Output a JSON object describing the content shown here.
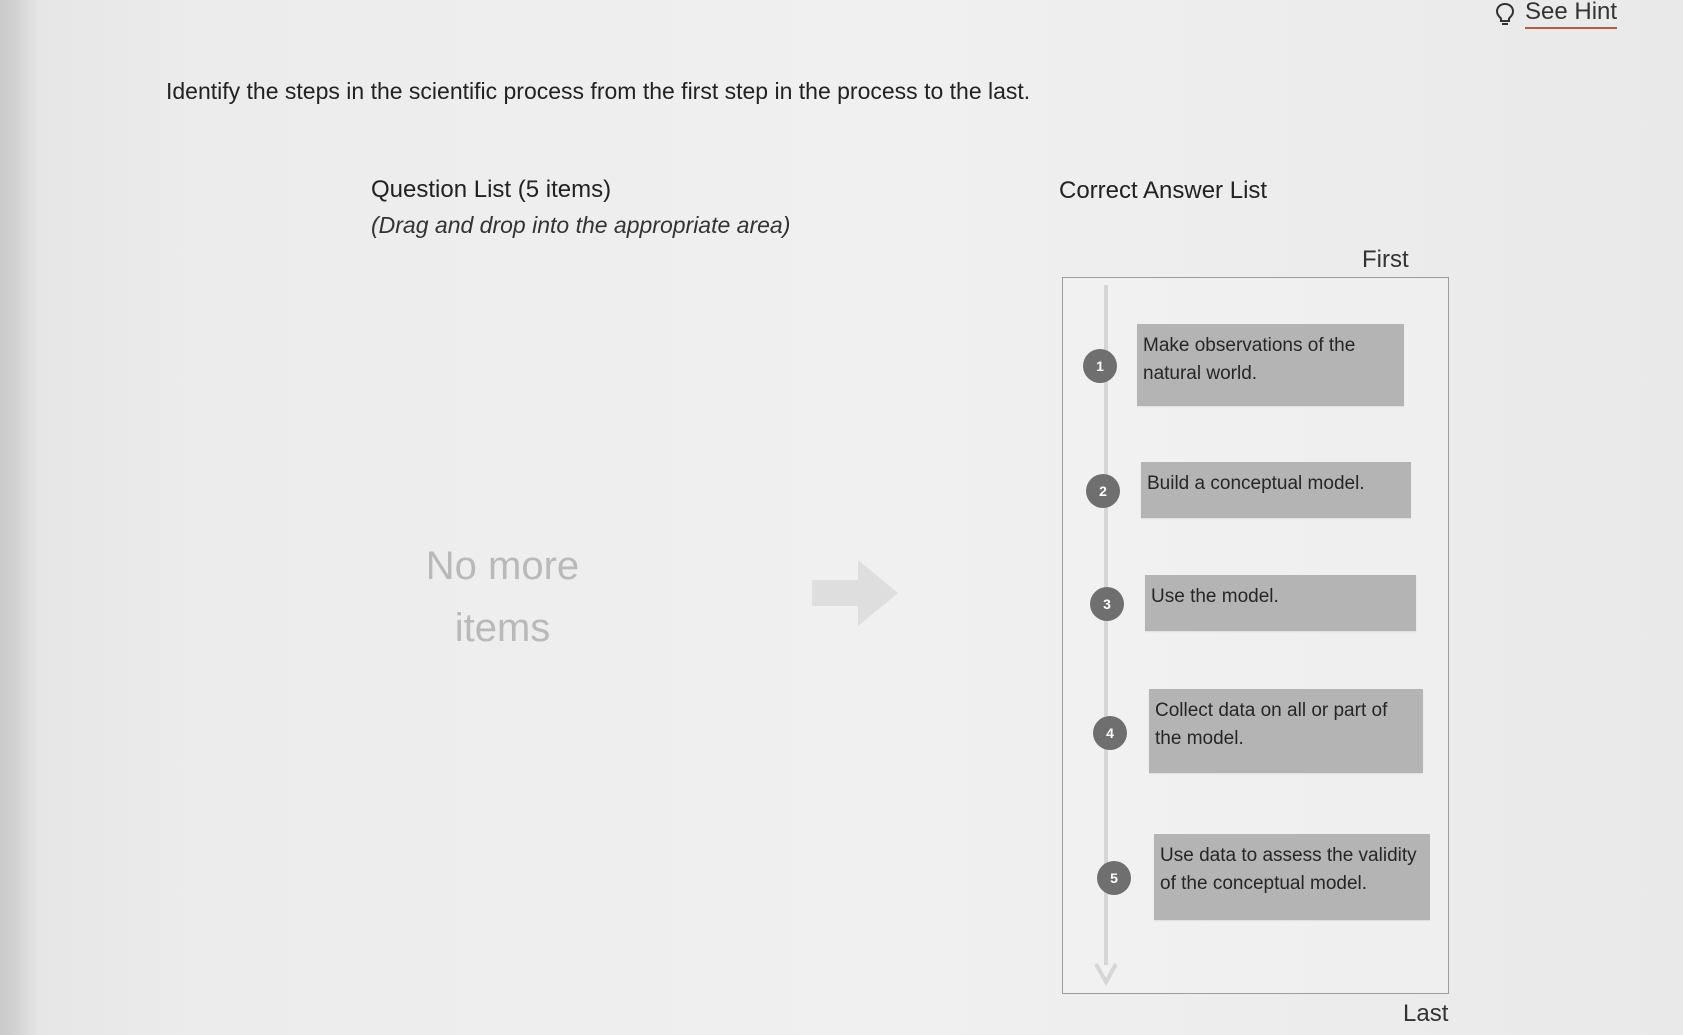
{
  "hint": {
    "label": "See Hint",
    "icon": "lightbulb-icon"
  },
  "prompt": "Identify the steps in the scientific process from the first step in the process to the last.",
  "question_list": {
    "title": "Question List (5 items)",
    "subtitle": "(Drag and drop into the appropriate area)",
    "empty_message": "No more items",
    "arrow_icon": "right-arrow-icon"
  },
  "answer_list": {
    "title": "Correct Answer List",
    "first_label": "First",
    "last_label": "Last",
    "steps": [
      {
        "number": "1",
        "text": "Make observations of the natural world."
      },
      {
        "number": "2",
        "text": "Build a conceptual model."
      },
      {
        "number": "3",
        "text": "Use the model."
      },
      {
        "number": "4",
        "text": "Collect data on all or part of the model."
      },
      {
        "number": "5",
        "text": "Use data to assess the validity of the conceptual model."
      }
    ]
  },
  "colors": {
    "card_background": "#b4b4b4",
    "number_badge": "#6f6f6f",
    "hint_underline": "#b35c3e"
  }
}
